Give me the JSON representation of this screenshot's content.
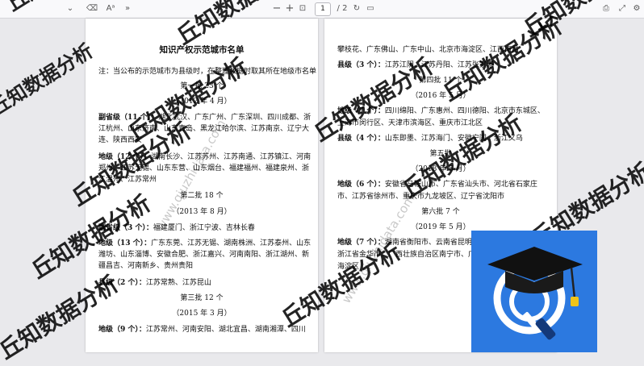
{
  "toolbar": {
    "minus": "−",
    "plus": "+",
    "current_page": "1",
    "page_count": "/ 2",
    "text_tool": "Aᵃ",
    "more": "»"
  },
  "page1": {
    "title": "知识产权示范城市名单",
    "note": "注：当公布的示范城市为县级时，在整理数据时取其所在地级市名单",
    "batch1": "第一批 23 个",
    "batch1_date": "（2012 年 4 月）",
    "b1_sub_label": "副省级（11 个）：",
    "b1_sub_line1": "湖北武汉、广东广州、广东深圳、四川成都、浙",
    "b1_sub_line2": "江杭州、山东济南、山东青岛、黑龙江哈尔滨、江苏南京、辽宁大",
    "b1_sub_line3": "连、陕西西安",
    "b1_pref_label": "地级（12 个）：",
    "b1_pref_line1": "湖南长沙、江苏苏州、江苏南通、江苏镇江、河南",
    "b1_pref_line2": "郑州、江苏无锡、山东东营、山东烟台、福建福州、福建泉州、浙",
    "b1_pref_line3": "江温州、江苏常州",
    "batch2": "第二批 18 个",
    "batch2_date": "（2013 年 8 月）",
    "b2_sub_label": "副省级（3 个）：",
    "b2_sub_text": "福建厦门、浙江宁波、吉林长春",
    "b2_pref_label": "地级（13 个）：",
    "b2_pref_line1": "广东东莞、江苏无锡、湖南株洲、江苏泰州、山东",
    "b2_pref_line2": "潍坊、山东淄博、安徽合肥、浙江嘉兴、河南南阳、浙江湖州、新",
    "b2_pref_line3": "疆昌吉、河南新乡、贵州贵阳",
    "b2_county_label": "县级（2 个）：",
    "b2_county_text": "江苏常熟、江苏昆山",
    "batch3": "第三批 12 个",
    "batch3_date": "（2015 年 3 月）",
    "b3_pref_label": "地级（9 个）：",
    "b3_pref_line1": "江苏常州、河南安阳、湖北宜昌、湖南湘潭、四川"
  },
  "page2": {
    "line1": "攀枝花、广东佛山、广东中山、北京市海淀区、江西南昌",
    "b3_county_label": "县级（3 个）：",
    "b3_county_text": "江苏江阴、江苏丹阳、江苏张家港",
    "batch4": "第四批 11 个",
    "batch4_date": "（2016 年 5 月）",
    "b4_pref_label": "地级（7 个）：",
    "b4_pref_line1": "四川绵阳、广东惠州、四川德阳、北京市东城区、",
    "b4_pref_line2": "上海市闵行区、天津市滨海区、重庆市江北区",
    "b4_county_label": "县级（4 个）：",
    "b4_county_text": "山东即墨、江苏海门、安徽宁国、浙江义乌",
    "batch5": "第五批",
    "batch5_date": "（2018 年 5 月）",
    "b5_pref_label": "地级（6 个）：",
    "b5_pref_line1": "安徽省马鞍山市、广东省汕头市、河北省石家庄",
    "b5_pref_line2": "市、江苏省徐州市、重庆市九龙坡区、辽宁省沈阳市",
    "batch6": "第六批 7 个",
    "batch6_date": "（2019 年 5 月）",
    "b6_pref_label": "地级（7 个）：",
    "b6_pref_line1": "湖南省衡阳市、云南省昆明",
    "b6_pref_line2": "浙江省金华市、广西壮族自治区南宁市、广",
    "b6_pref_line3": "海淀区"
  },
  "watermark": {
    "text": "丘知数据分析",
    "url": "www.qiuzhidata.com"
  },
  "colors": {
    "logo_bg": "#2c79e0",
    "logo_ring": "#ffffff",
    "cap": "#111111",
    "tassel": "#f0c419"
  }
}
